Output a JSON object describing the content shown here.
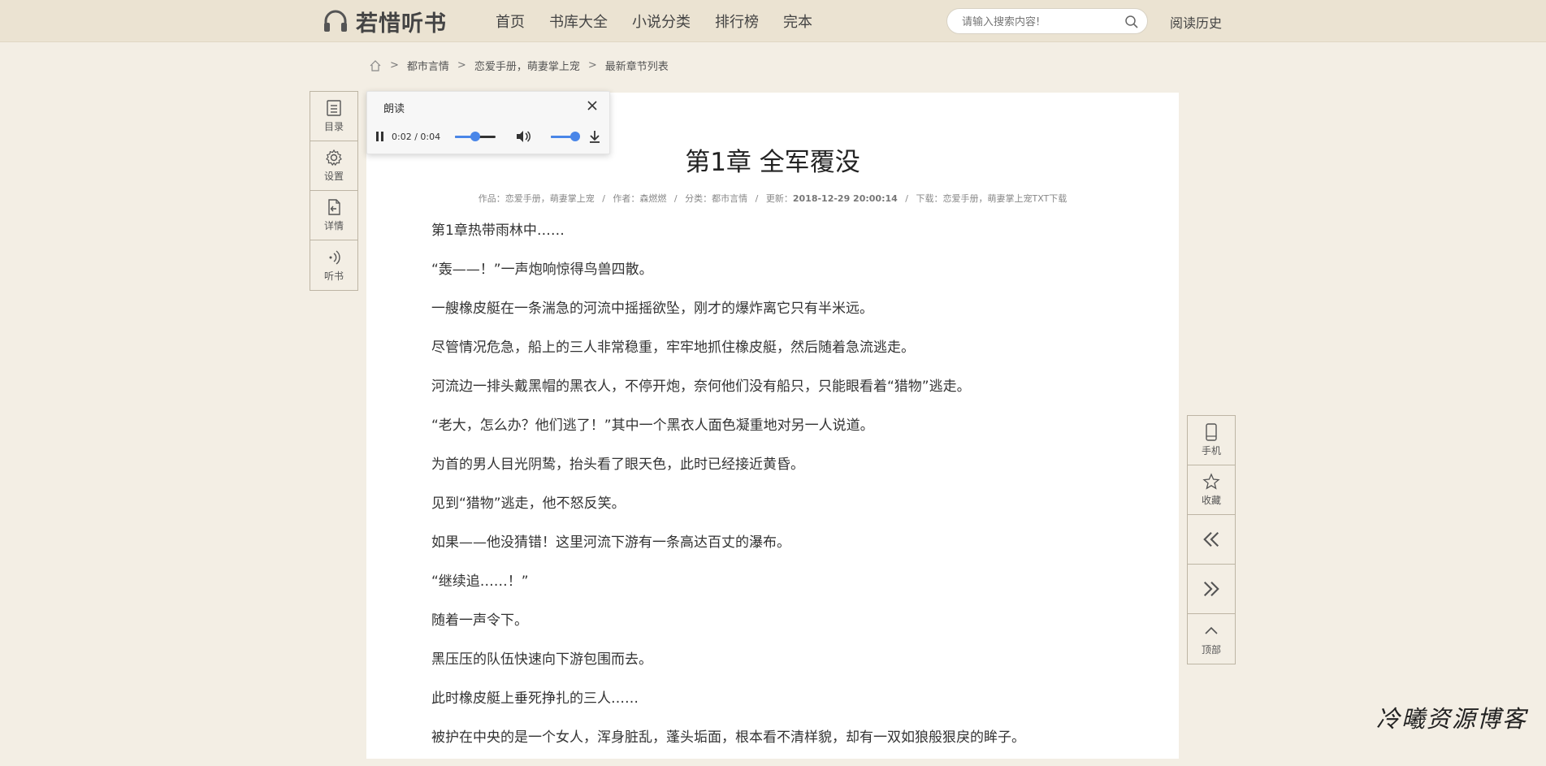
{
  "header": {
    "logo_text": "若惜听书",
    "nav": [
      "首页",
      "书库大全",
      "小说分类",
      "排行榜",
      "完本"
    ],
    "search_placeholder": "请输入搜索内容!",
    "history_label": "阅读历史"
  },
  "breadcrumb": {
    "items": [
      "都市言情",
      "恋爱手册，萌妻掌上宠",
      "最新章节列表"
    ]
  },
  "left_tools": [
    "目录",
    "设置",
    "详情",
    "听书"
  ],
  "right_tools": [
    "手机",
    "收藏",
    "",
    "",
    "顶部"
  ],
  "player": {
    "title": "朗读",
    "time": "0:02 / 0:04",
    "progress": 0.5,
    "volume": 1.0
  },
  "chapter": {
    "title": "第1章  全军覆没",
    "meta": {
      "work": "作品：恋爱手册，萌妻掌上宠",
      "author": "作者：森燃燃",
      "category": "分类：都市言情",
      "updated_label": "更新：",
      "updated": "2018-12-29  20:00:14",
      "download_label": "下载：",
      "download": "恋爱手册，萌妻掌上宠TXT下载"
    },
    "paragraphs": [
      "第1章热带雨林中……",
      "“轰——！”一声炮响惊得鸟兽四散。",
      "一艘橡皮艇在一条湍急的河流中摇摇欲坠，刚才的爆炸离它只有半米远。",
      "尽管情况危急，船上的三人非常稳重，牢牢地抓住橡皮艇，然后随着急流逃走。",
      "河流边一排头戴黑帽的黑衣人，不停开炮，奈何他们没有船只，只能眼看着“猎物”逃走。",
      "“老大，怎么办？他们逃了！”其中一个黑衣人面色凝重地对另一人说道。",
      "为首的男人目光阴鸷，抬头看了眼天色，此时已经接近黄昏。",
      "见到“猎物”逃走，他不怒反笑。",
      "如果——他没猜错！这里河流下游有一条高达百丈的瀑布。",
      "“继续追……！”",
      "随着一声令下。",
      "黑压压的队伍快速向下游包围而去。",
      "此时橡皮艇上垂死挣扎的三人……",
      "被护在中央的是一个女人，浑身脏乱，蓬头垢面，根本看不清样貌，却有一双如狼般狠戾的眸子。"
    ]
  },
  "watermark": "冷曦资源博客"
}
